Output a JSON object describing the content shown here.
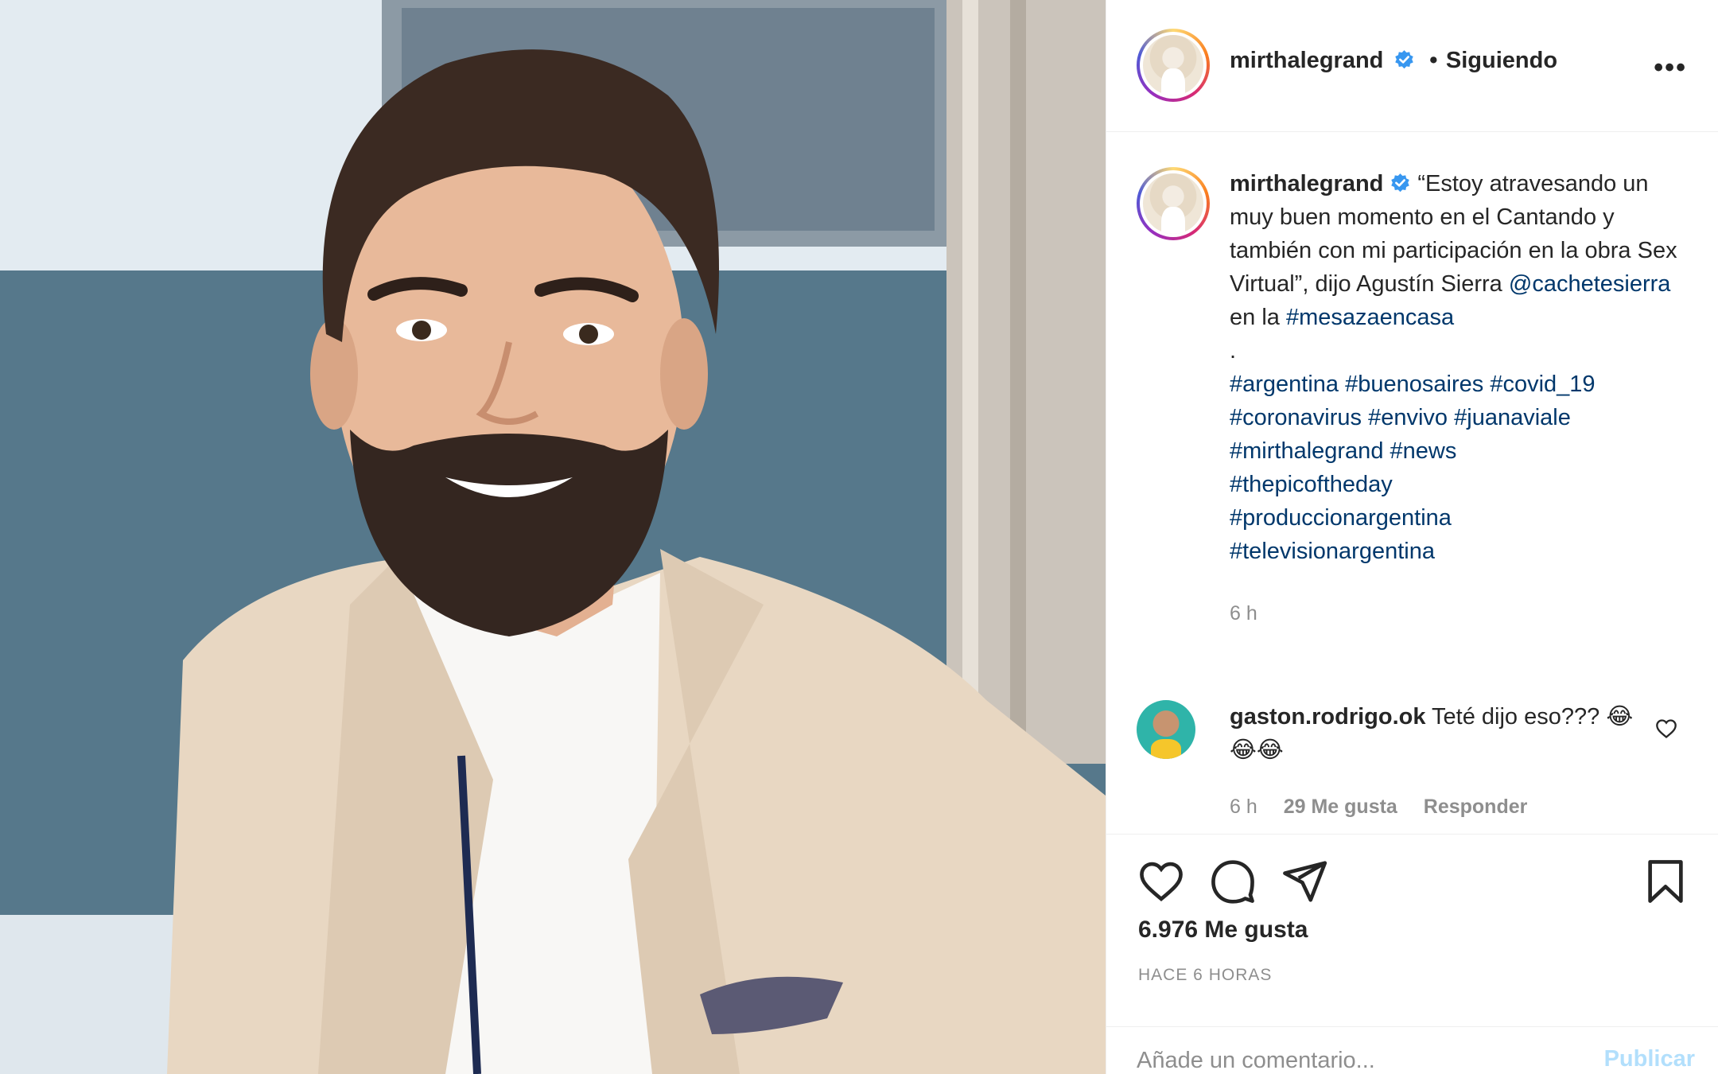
{
  "header": {
    "username": "mirthalegrand",
    "separator": "•",
    "follow_status": "Siguiendo",
    "more": "•••",
    "avatar_icon": "profile-avatar",
    "verified_icon": "verified-badge"
  },
  "caption": {
    "username": "mirthalegrand",
    "text_part1": "“Estoy atravesando un muy buen momento en el Cantando y también con mi participación en la obra Sex Virtual”, dijo Agustín Sierra ",
    "mention": "@cachetesierra",
    "text_part2": " en la ",
    "hashtag_intro": "#mesazaencasa",
    "dot": ".",
    "hashtags": [
      "#argentina",
      "#buenosaires",
      "#covid_19",
      "#coronavirus",
      "#envivo",
      "#juanaviale",
      "#mirthalegrand",
      "#news",
      "#thepicoftheday",
      "#produccionargentina",
      "#televisionargentina"
    ],
    "time": "6 h"
  },
  "comment": {
    "username": "gaston.rodrigo.ok",
    "text": "Teté dijo eso??? 😂😂😂",
    "time": "6 h",
    "likes": "29 Me gusta",
    "reply": "Responder"
  },
  "actions": {
    "likes": "6.976 Me gusta",
    "ago": "HACE 6 HORAS",
    "icons": [
      "heart-icon",
      "comment-icon",
      "share-icon",
      "bookmark-icon"
    ]
  },
  "add_comment": {
    "placeholder": "Añade un comentario...",
    "publish": "Publicar"
  },
  "colors": {
    "link": "#00376b",
    "verified": "#3897f0",
    "publish_disabled": "#b2dffc",
    "muted": "#8e8e8e"
  }
}
